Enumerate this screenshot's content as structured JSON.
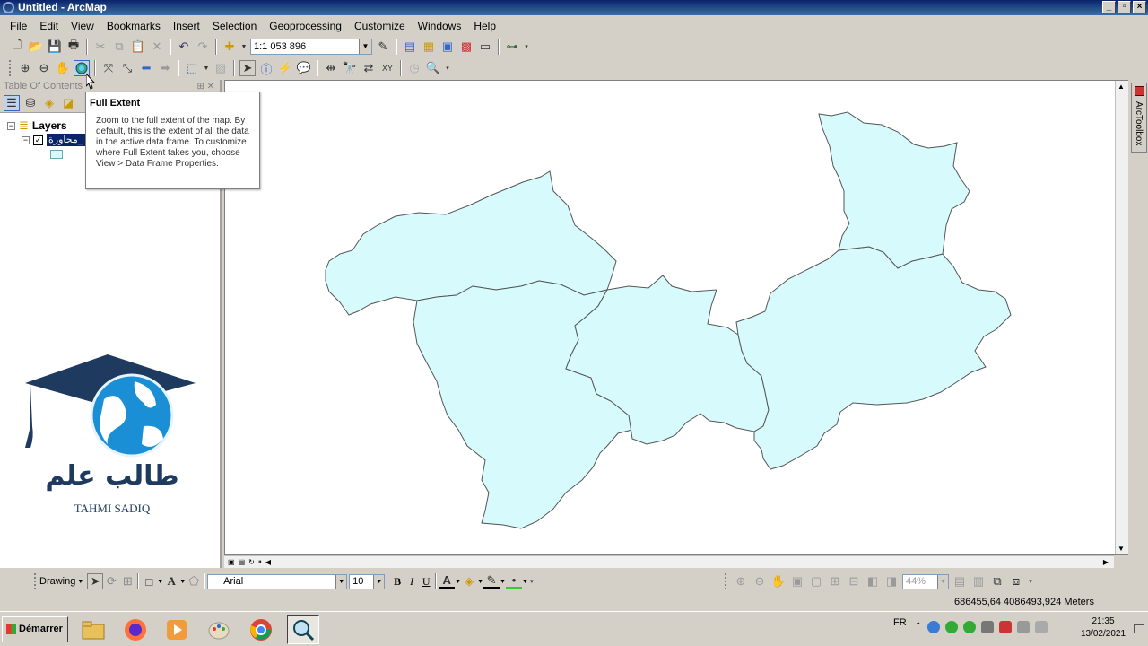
{
  "window": {
    "title": "Untitled - ArcMap"
  },
  "menu": [
    "File",
    "Edit",
    "View",
    "Bookmarks",
    "Insert",
    "Selection",
    "Geoprocessing",
    "Customize",
    "Windows",
    "Help"
  ],
  "toolbar": {
    "scale": "1:1 053 896"
  },
  "toc": {
    "title": "Table Of Contents",
    "root": "Layers",
    "layer": "محاورة_"
  },
  "tooltip": {
    "title": "Full Extent",
    "body": "Zoom to the full extent of the map. By default, this is the extent of all the data in the active data frame. To customize where Full Extent takes you, choose View > Data Frame Properties."
  },
  "logo": {
    "arabic": "طالب علم",
    "latin": "TAHMI SADIQ"
  },
  "arctoolbox": "ArcToolbox",
  "drawing": {
    "label": "Drawing",
    "font": "Arial",
    "size": "10",
    "bold": "B",
    "italic": "I",
    "underline": "U",
    "zoom": "44%"
  },
  "status": {
    "coordinates": "686455,64  4086493,924 Meters"
  },
  "taskbar": {
    "start": "Démarrer",
    "lang": "FR",
    "time": "21:35",
    "date": "13/02/2021"
  },
  "colors": {
    "fill": "#d7fbfd",
    "outline": "#555555",
    "title_bar": "#0a246a"
  }
}
